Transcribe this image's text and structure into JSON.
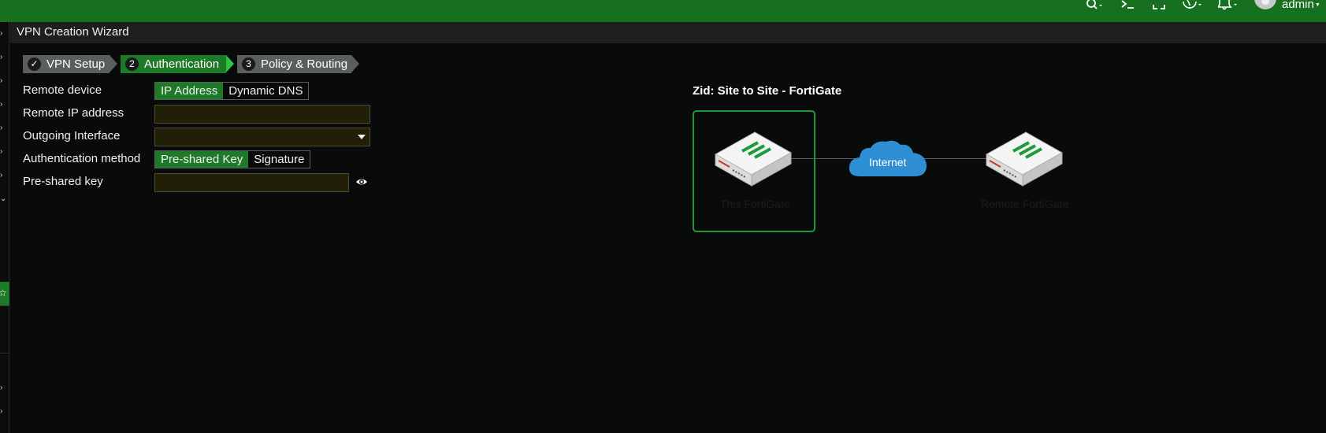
{
  "topbar": {
    "icons": [
      "search-icon",
      "terminal-icon",
      "fullscreen-icon",
      "help-icon",
      "bell-icon"
    ],
    "user": "admin"
  },
  "wizard": {
    "title": "VPN Creation Wizard",
    "steps": [
      {
        "num": "✓",
        "label": "VPN Setup",
        "state": "done"
      },
      {
        "num": "2",
        "label": "Authentication",
        "state": "active"
      },
      {
        "num": "3",
        "label": "Policy & Routing",
        "state": "todo"
      }
    ]
  },
  "form": {
    "remote_device": {
      "label": "Remote device",
      "options": [
        "IP Address",
        "Dynamic DNS"
      ],
      "selected": "IP Address"
    },
    "remote_ip": {
      "label": "Remote IP address",
      "value": ""
    },
    "outgoing_interface": {
      "label": "Outgoing Interface",
      "value": ""
    },
    "auth_method": {
      "label": "Authentication method",
      "options": [
        "Pre-shared Key",
        "Signature"
      ],
      "selected": "Pre-shared Key"
    },
    "psk": {
      "label": "Pre-shared key",
      "value": ""
    }
  },
  "diagram": {
    "title": "Zid: Site to Site - FortiGate",
    "local_label": "This FortiGate",
    "cloud_label": "Internet",
    "remote_label": "Remote FortiGate"
  },
  "colors": {
    "brand_green": "#16701f",
    "active_green": "#1e7a28",
    "cloud_blue": "#2f8fd4"
  }
}
